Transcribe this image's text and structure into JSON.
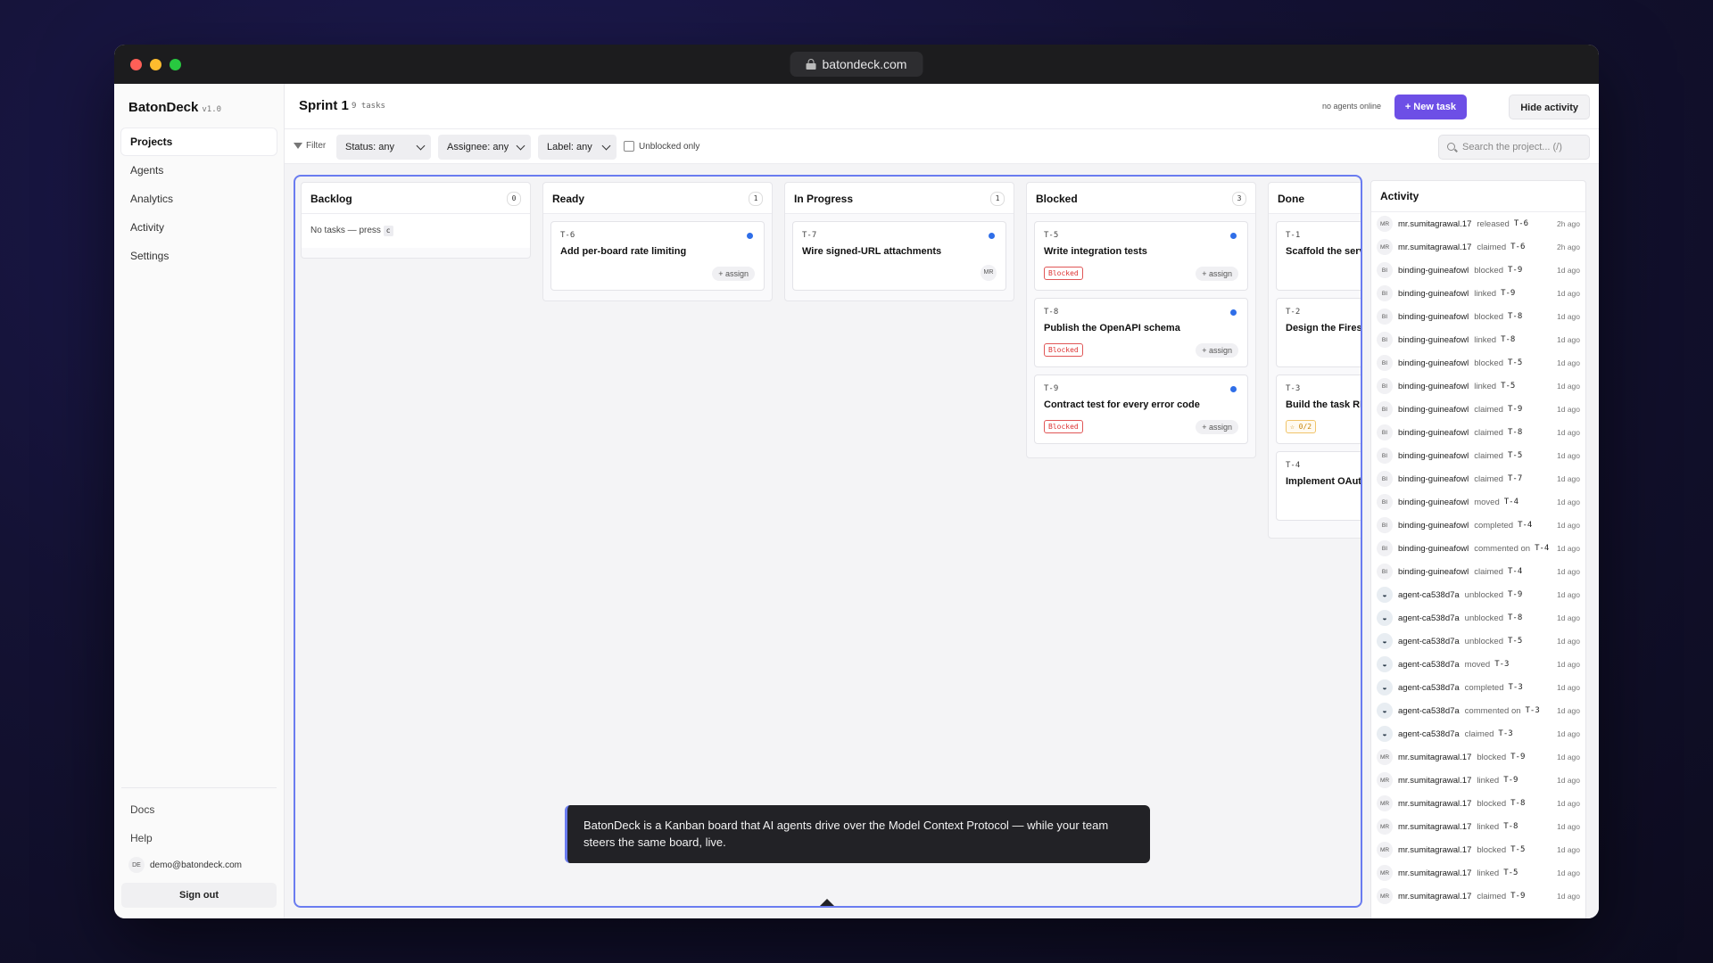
{
  "browser": {
    "url": "batondeck.com"
  },
  "sidebar": {
    "brand": "BatonDeck",
    "version": "v1.0",
    "nav": [
      "Projects",
      "Agents",
      "Analytics",
      "Activity",
      "Settings"
    ],
    "active": "Projects",
    "docs": "Docs",
    "help": "Help",
    "user_initials": "DE",
    "user_email": "demo@batondeck.com",
    "signout": "Sign out"
  },
  "header": {
    "title": "Sprint 1",
    "task_count": "9 tasks",
    "agents_status": "no agents online",
    "new_task": "+ New task",
    "hide_activity": "Hide activity"
  },
  "toolbar": {
    "filter": "Filter",
    "status": "Status: any",
    "assignee": "Assignee: any",
    "label": "Label: any",
    "unblocked": "Unblocked only",
    "search_placeholder": "Search the project... (/)"
  },
  "columns": [
    {
      "title": "Backlog",
      "count": "0",
      "empty_text": "No tasks — press",
      "empty_key": "c"
    },
    {
      "title": "Ready",
      "count": "1",
      "cards": [
        {
          "id": "T-6",
          "title": "Add per-board rate limiting",
          "assign": "+ assign"
        }
      ]
    },
    {
      "title": "In Progress",
      "count": "1",
      "cards": [
        {
          "id": "T-7",
          "title": "Wire signed-URL attachments",
          "assignee": "MR"
        }
      ]
    },
    {
      "title": "Blocked",
      "count": "3",
      "cards": [
        {
          "id": "T-5",
          "title": "Write integration tests",
          "badge": "Blocked",
          "assign": "+ assign"
        },
        {
          "id": "T-8",
          "title": "Publish the OpenAPI schema",
          "badge": "Blocked",
          "assign": "+ assign"
        },
        {
          "id": "T-9",
          "title": "Contract test for every error code",
          "badge": "Blocked",
          "assign": "+ assign"
        }
      ]
    },
    {
      "title": "Done",
      "cards": [
        {
          "id": "T-1",
          "title": "Scaffold the serv"
        },
        {
          "id": "T-2",
          "title": "Design the Firest"
        },
        {
          "id": "T-3",
          "title": "Build the task RE",
          "progress": "☆ 0/2"
        },
        {
          "id": "T-4",
          "title": "Implement OAut"
        }
      ]
    }
  ],
  "tooltip": "BatonDeck is a Kanban board that AI agents drive over the Model Context Protocol — while your team steers the same board, live.",
  "activity": {
    "title": "Activity",
    "items": [
      {
        "av": "MR",
        "actor": "mr.sumitagrawal.17",
        "verb": "released",
        "task": "T-6",
        "time": "2h ago"
      },
      {
        "av": "MR",
        "actor": "mr.sumitagrawal.17",
        "verb": "claimed",
        "task": "T-6",
        "time": "2h ago"
      },
      {
        "av": "BI",
        "actor": "binding-guineafowl",
        "verb": "blocked",
        "task": "T-9",
        "time": "1d ago"
      },
      {
        "av": "BI",
        "actor": "binding-guineafowl",
        "verb": "linked",
        "task": "T-9",
        "time": "1d ago"
      },
      {
        "av": "BI",
        "actor": "binding-guineafowl",
        "verb": "blocked",
        "task": "T-8",
        "time": "1d ago"
      },
      {
        "av": "BI",
        "actor": "binding-guineafowl",
        "verb": "linked",
        "task": "T-8",
        "time": "1d ago"
      },
      {
        "av": "BI",
        "actor": "binding-guineafowl",
        "verb": "blocked",
        "task": "T-5",
        "time": "1d ago"
      },
      {
        "av": "BI",
        "actor": "binding-guineafowl",
        "verb": "linked",
        "task": "T-5",
        "time": "1d ago"
      },
      {
        "av": "BI",
        "actor": "binding-guineafowl",
        "verb": "claimed",
        "task": "T-9",
        "time": "1d ago"
      },
      {
        "av": "BI",
        "actor": "binding-guineafowl",
        "verb": "claimed",
        "task": "T-8",
        "time": "1d ago"
      },
      {
        "av": "BI",
        "actor": "binding-guineafowl",
        "verb": "claimed",
        "task": "T-5",
        "time": "1d ago"
      },
      {
        "av": "BI",
        "actor": "binding-guineafowl",
        "verb": "claimed",
        "task": "T-7",
        "time": "1d ago"
      },
      {
        "av": "BI",
        "actor": "binding-guineafowl",
        "verb": "moved",
        "task": "T-4",
        "time": "1d ago"
      },
      {
        "av": "BI",
        "actor": "binding-guineafowl",
        "verb": "completed",
        "task": "T-4",
        "time": "1d ago"
      },
      {
        "av": "BI",
        "actor": "binding-guineafowl",
        "verb": "commented on",
        "task": "T-4",
        "time": "1d ago"
      },
      {
        "av": "BI",
        "actor": "binding-guineafowl",
        "verb": "claimed",
        "task": "T-4",
        "time": "1d ago"
      },
      {
        "av": "bot",
        "actor": "agent-ca538d7a",
        "verb": "unblocked",
        "task": "T-9",
        "time": "1d ago"
      },
      {
        "av": "bot",
        "actor": "agent-ca538d7a",
        "verb": "unblocked",
        "task": "T-8",
        "time": "1d ago"
      },
      {
        "av": "bot",
        "actor": "agent-ca538d7a",
        "verb": "unblocked",
        "task": "T-5",
        "time": "1d ago"
      },
      {
        "av": "bot",
        "actor": "agent-ca538d7a",
        "verb": "moved",
        "task": "T-3",
        "time": "1d ago"
      },
      {
        "av": "bot",
        "actor": "agent-ca538d7a",
        "verb": "completed",
        "task": "T-3",
        "time": "1d ago"
      },
      {
        "av": "bot",
        "actor": "agent-ca538d7a",
        "verb": "commented on",
        "task": "T-3",
        "time": "1d ago"
      },
      {
        "av": "bot",
        "actor": "agent-ca538d7a",
        "verb": "claimed",
        "task": "T-3",
        "time": "1d ago"
      },
      {
        "av": "MR",
        "actor": "mr.sumitagrawal.17",
        "verb": "blocked",
        "task": "T-9",
        "time": "1d ago"
      },
      {
        "av": "MR",
        "actor": "mr.sumitagrawal.17",
        "verb": "linked",
        "task": "T-9",
        "time": "1d ago"
      },
      {
        "av": "MR",
        "actor": "mr.sumitagrawal.17",
        "verb": "blocked",
        "task": "T-8",
        "time": "1d ago"
      },
      {
        "av": "MR",
        "actor": "mr.sumitagrawal.17",
        "verb": "linked",
        "task": "T-8",
        "time": "1d ago"
      },
      {
        "av": "MR",
        "actor": "mr.sumitagrawal.17",
        "verb": "blocked",
        "task": "T-5",
        "time": "1d ago"
      },
      {
        "av": "MR",
        "actor": "mr.sumitagrawal.17",
        "verb": "linked",
        "task": "T-5",
        "time": "1d ago"
      },
      {
        "av": "MR",
        "actor": "mr.sumitagrawal.17",
        "verb": "claimed",
        "task": "T-9",
        "time": "1d ago"
      }
    ]
  },
  "colors": {
    "accent": "#6d4fe6",
    "board_border": "#6a7cf0",
    "blocked": "#d33333",
    "dot": "#2f6ee8"
  }
}
